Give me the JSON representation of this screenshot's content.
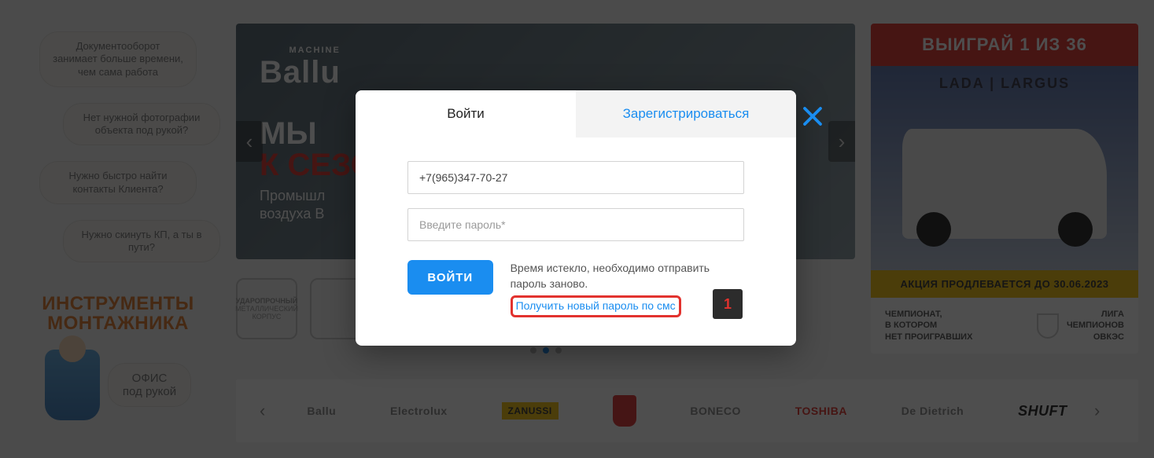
{
  "left": {
    "cloud1": "Документооборот занимает больше времени, чем сама работа",
    "cloud2": "Нет нужной фотографии объекта под рукой?",
    "cloud3": "Нужно быстро найти контакты Клиента?",
    "cloud4": "Нужно скинуть КП, а ты в пути?",
    "title_line1": "ИНСТРУМЕНТЫ",
    "title_line2": "МОНТАЖНИКА",
    "office_line1": "ОФИС",
    "office_line2": "под рукой"
  },
  "slider": {
    "brand_sup": "MACHINE",
    "brand_name": "Ballu",
    "headline1": "МЫ",
    "headline2": "К СЕЗО",
    "sub1": "Промышл",
    "sub2": "воздуха B",
    "badge1": "УДАРОПРОЧНЫЙ",
    "badge1_sub": "МЕТАЛЛИЧЕСКИЙ КОРПУС"
  },
  "promo": {
    "top": "ВЫИГРАЙ 1 ИЗ 36",
    "lada": "LADA   |   LARGUS",
    "yellow": "АКЦИЯ ПРОДЛЕВАЕТСЯ ДО 30.06.2023",
    "champ1": "ЧЕМПИОНАТ,",
    "champ2": "В КОТОРОМ",
    "champ3": "НЕТ ПРОИГРАВШИХ",
    "liga1": "ЛИГА",
    "liga2": "ЧЕМПИОНОВ",
    "liga3": "ОВКЭС"
  },
  "brands": {
    "b1": "Ballu",
    "b2": "Electrolux",
    "b3": "ZANUSSI",
    "b5": "BONECO",
    "b6": "TOSHIBA",
    "b7": "De Dietrich",
    "b8": "SHUFT"
  },
  "modal": {
    "tab_login": "Войти",
    "tab_register": "Зарегистрироваться",
    "phone_value": "+7(965)347-70-27",
    "password_placeholder": "Введите пароль*",
    "submit": "ВОЙТИ",
    "timeout_msg": "Время истекло, необходимо отправить пароль заново.",
    "sms_link": "Получить новый пароль по смс"
  },
  "annotation": {
    "n1": "1"
  }
}
